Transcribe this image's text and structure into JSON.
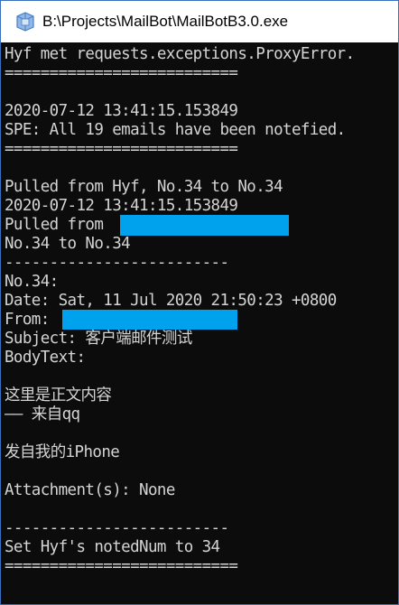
{
  "window": {
    "title": "B:\\Projects\\MailBot\\MailBotB3.0.exe",
    "icon": "app-window-icon"
  },
  "console": {
    "lines": [
      "Hyf met requests.exceptions.ProxyError.",
      "==========================",
      "",
      "2020-07-12 13:41:15.153849",
      "SPE: All 19 emails have been notefied.",
      "==========================",
      "",
      "Pulled from Hyf, No.34 to No.34",
      "2020-07-12 13:41:15.153849",
      "Pulled from",
      "No.34 to No.34",
      "-------------------------",
      "No.34:",
      "Date: Sat, 11 Jul 2020 21:50:23 +0800",
      "From:",
      "Subject: 客户端邮件测试",
      "BodyText:",
      "",
      "这里是正文内容",
      "—— 来自qq",
      "",
      "发自我的iPhone",
      "",
      "Attachment(s): None",
      "",
      "-------------------------",
      "Set Hyf's notedNum to 34",
      "=========================="
    ]
  },
  "colors": {
    "console_bg": "#0c0c0c",
    "console_text": "#d4d4d4",
    "redaction": "#00a2ed",
    "titlebar_bg": "#ffffff"
  }
}
